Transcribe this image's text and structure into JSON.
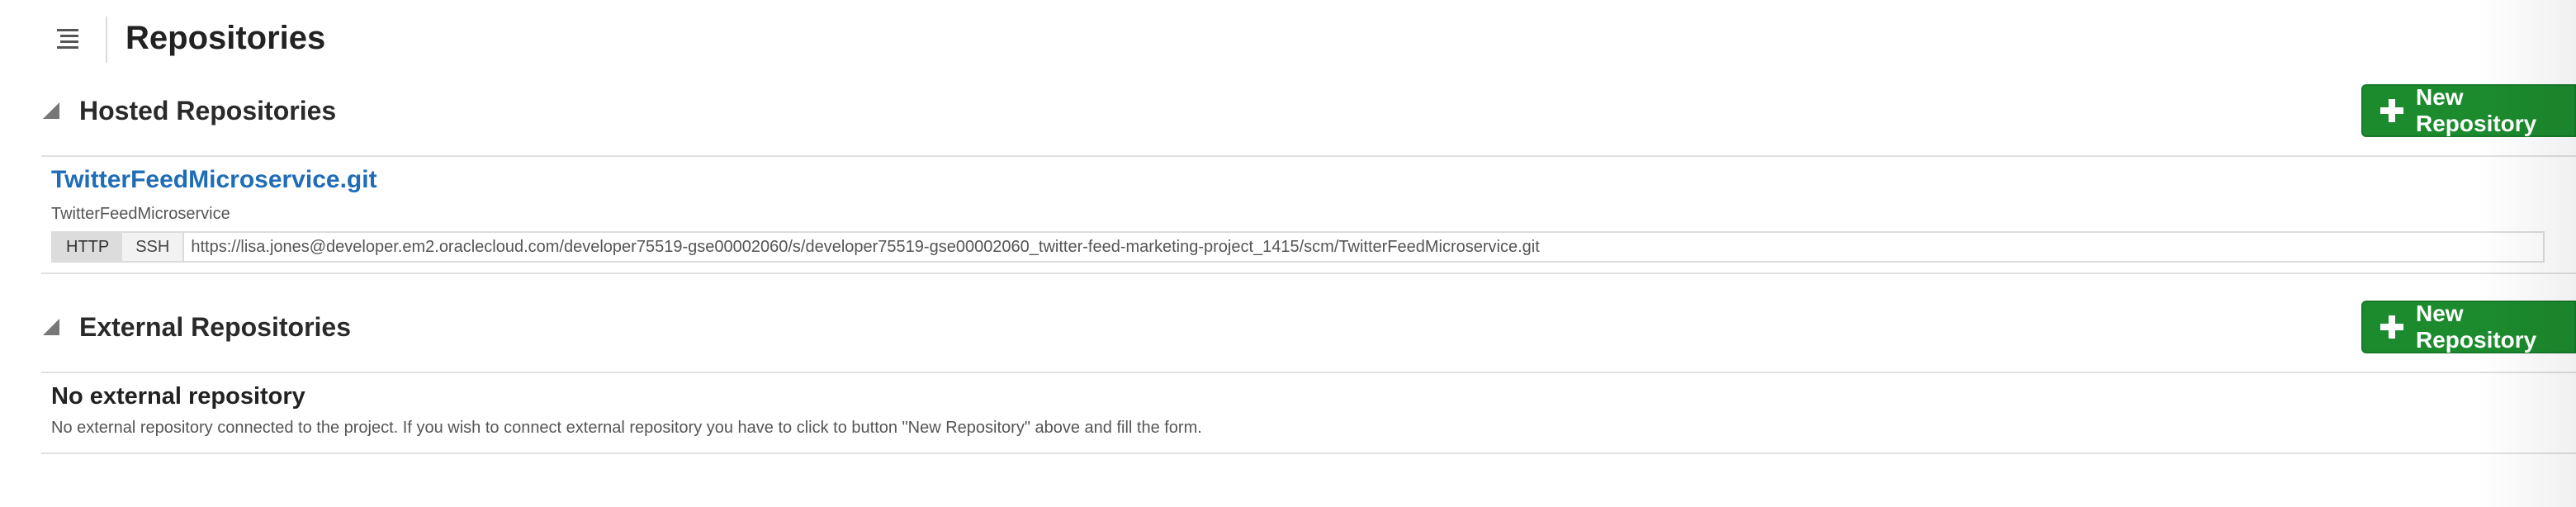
{
  "header": {
    "title": "Repositories",
    "menu_icon": "list-menu-icon"
  },
  "hosted": {
    "title": "Hosted Repositories",
    "new_button_label": "New Repository",
    "repositories": [
      {
        "name": "TwitterFeedMicroservice.git",
        "description": "TwitterFeedMicroservice",
        "protocols": [
          "HTTP",
          "SSH"
        ],
        "active_protocol": "HTTP",
        "url": "https://lisa.jones@developer.em2.oraclecloud.com/developer75519-gse00002060/s/developer75519-gse00002060_twitter-feed-marketing-project_1415/scm/TwitterFeedMicroservice.git"
      }
    ]
  },
  "external": {
    "title": "External Repositories",
    "new_button_label": "New Repository",
    "empty_title": "No external repository",
    "empty_text": "No external repository connected to the project. If you wish to connect external repository you have to click to button \"New Repository\" above and fill the form."
  },
  "colors": {
    "accent_green": "#1c8b2e",
    "link_blue": "#1f6db7",
    "divider": "#e0e0e0"
  }
}
